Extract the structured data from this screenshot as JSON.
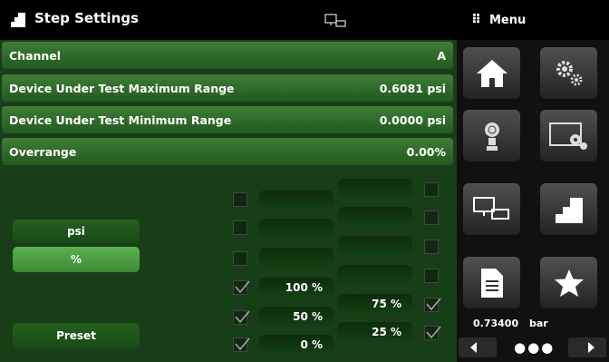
{
  "header": {
    "title": "Step Settings",
    "menu_label": "Menu",
    "menu_dots": "⠿"
  },
  "rows": [
    {
      "label": "Channel",
      "value": "A"
    },
    {
      "label": "Device Under Test Maximum Range",
      "value": "0.6081 psi"
    },
    {
      "label": "Device Under Test Minimum Range",
      "value": "0.0000 psi"
    },
    {
      "label": "Overrange",
      "value": "0.00%"
    }
  ],
  "units": {
    "psi_label": "psi",
    "percent_label": "%",
    "selected": "%",
    "preset_label": "Preset"
  },
  "steps_left": [
    {
      "value": "",
      "checked": false
    },
    {
      "value": "",
      "checked": false
    },
    {
      "value": "",
      "checked": false
    },
    {
      "value": "100 %",
      "checked": true
    },
    {
      "value": "50 %",
      "checked": true
    },
    {
      "value": "0 %",
      "checked": true
    }
  ],
  "steps_right": [
    {
      "value": "",
      "checked": false
    },
    {
      "value": "",
      "checked": false
    },
    {
      "value": "",
      "checked": false
    },
    {
      "value": "",
      "checked": false
    },
    {
      "value": "75 %",
      "checked": true
    },
    {
      "value": "25 %",
      "checked": true
    }
  ],
  "menu": {
    "tiles": [
      "home-icon",
      "settings-icon",
      "sensor-icon",
      "display-settings-icon",
      "remote-connection-icon",
      "step-icon",
      "document-icon",
      "favorites-icon"
    ],
    "reading_value": "0.73400",
    "reading_unit": "bar",
    "page_dots": "●●●"
  }
}
